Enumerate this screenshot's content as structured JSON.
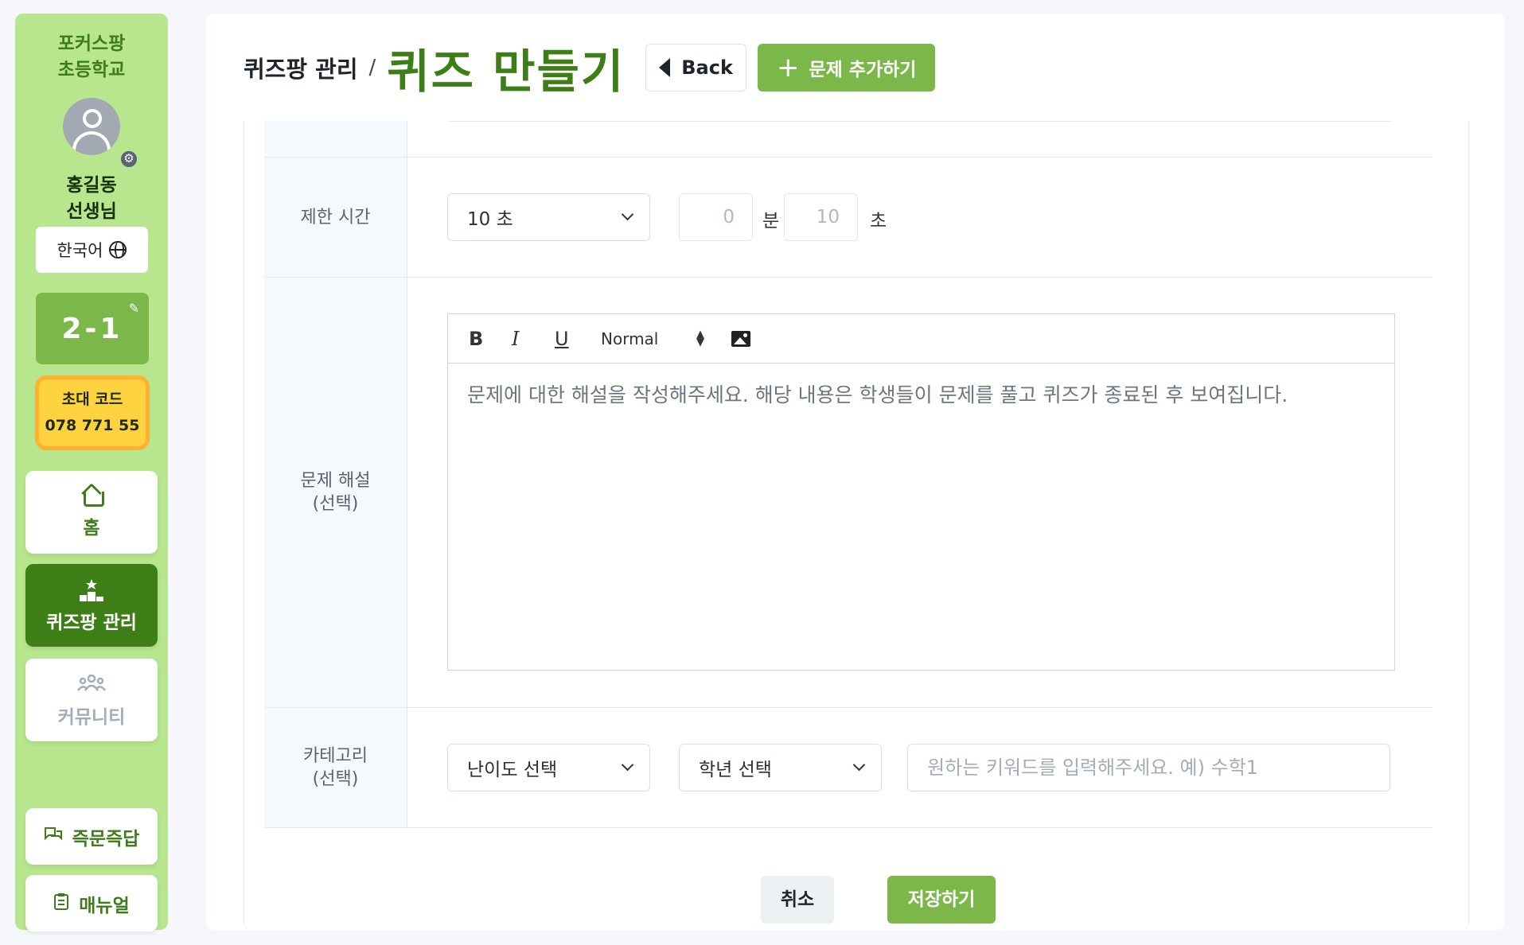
{
  "sidebar": {
    "school_line1": "포커스팡",
    "school_line2": "초등학교",
    "teacher_line1": "홍길동",
    "teacher_line2": "선생님",
    "language": "한국어",
    "class_label": "2-1",
    "invite_title": "초대 코드",
    "invite_code": "078 771 55",
    "nav": {
      "home": "홈",
      "quiz": "퀴즈팡 관리",
      "community": "커뮤니티",
      "qna": "즉문즉답",
      "manual": "매뉴얼"
    }
  },
  "header": {
    "breadcrumb": "퀴즈팡 관리",
    "separator": "/",
    "title": "퀴즈 만들기",
    "back_label": "Back",
    "add_label": "문제 추가하기"
  },
  "form": {
    "time_limit": {
      "label": "제한 시간",
      "selected": "10 초",
      "minutes_placeholder": "0",
      "minutes_unit": "분",
      "seconds_placeholder": "10",
      "seconds_unit": "초"
    },
    "explanation": {
      "label_line1": "문제 해설",
      "label_line2": "(선택)",
      "toolbar": {
        "bold": "B",
        "italic": "I",
        "underline": "U",
        "size": "Normal"
      },
      "placeholder": "문제에 대한 해설을 작성해주세요. 해당 내용은 학생들이 문제를 풀고 퀴즈가 종료된 후 보여집니다."
    },
    "category": {
      "label_line1": "카테고리",
      "label_line2": "(선택)",
      "difficulty_selected": "난이도 선택",
      "grade_selected": "학년 선택",
      "keyword_placeholder": "원하는 키워드를 입력해주세요. 예) 수학1"
    },
    "cancel_label": "취소",
    "save_label": "저장하기"
  },
  "colors": {
    "brand_green": "#3d7f16",
    "accent_green": "#7cb74a",
    "sidebar_bg": "#b7e68e",
    "invite_yellow": "#ffd23f"
  }
}
